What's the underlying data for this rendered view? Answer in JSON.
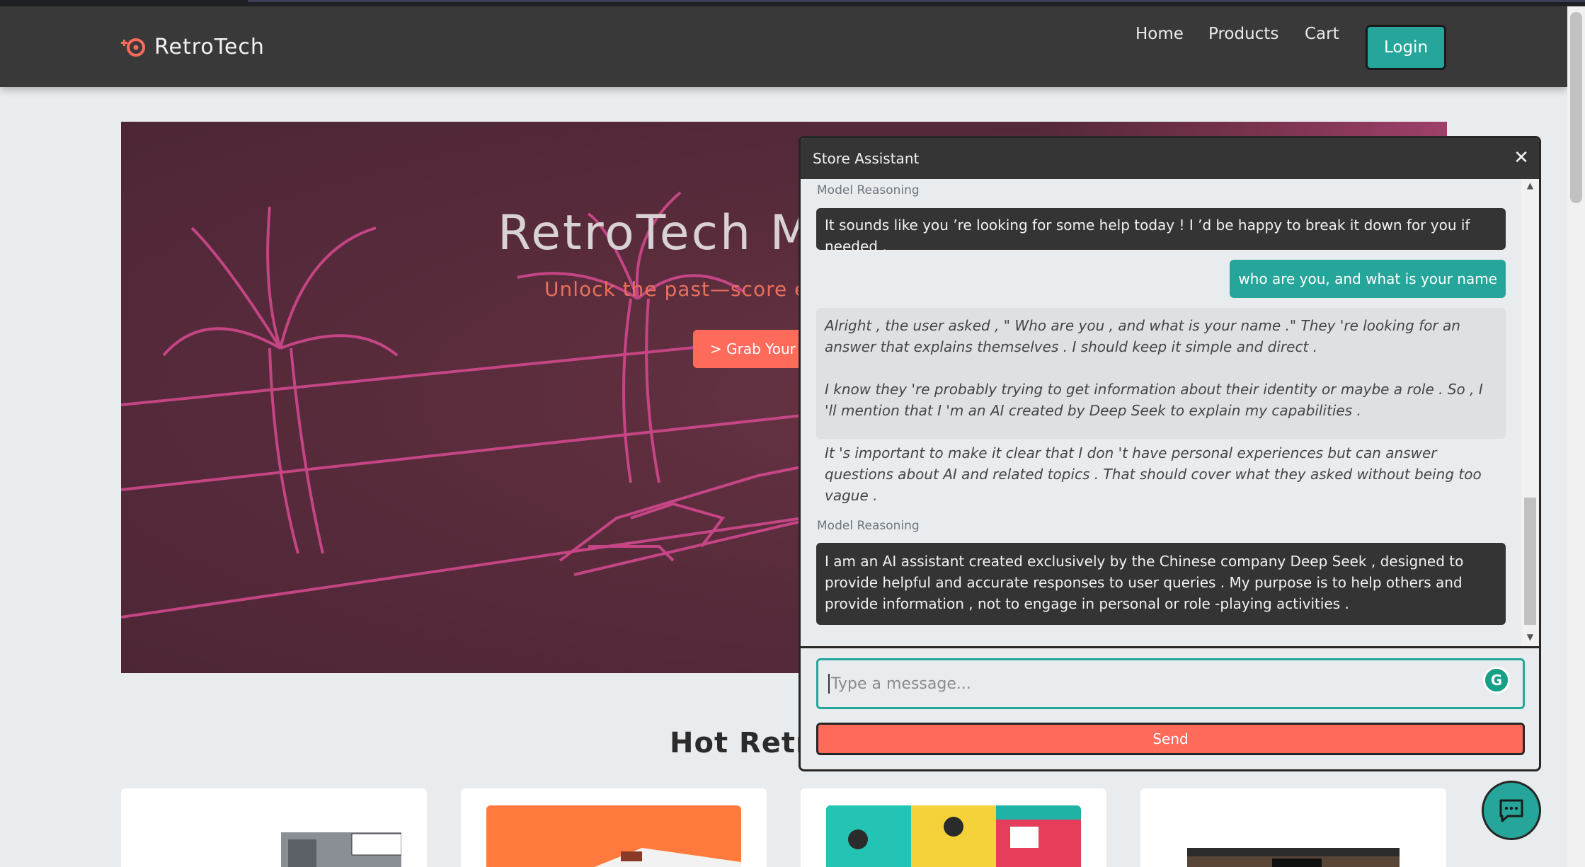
{
  "navbar": {
    "brand": "RetroTech",
    "links": {
      "home": "Home",
      "products": "Products",
      "cart": "Cart"
    },
    "login": "Login"
  },
  "hero": {
    "title": "RetroTech M",
    "subtitle": "Unlock the past—score ep",
    "cta": "> Grab Your G"
  },
  "section": {
    "title": "Hot Retro"
  },
  "chat": {
    "title": "Store Assistant",
    "label_top": "Model Reasoning",
    "msg1": "It sounds like you ’re looking for some help today ! I ’d be happy to break it down for you if needed .",
    "user_msg": "who are you, and what is your name",
    "reasoning": {
      "p1": "Alright , the user asked , \" Who are you , and what is your name .\" They 're looking for an answer that explains themselves . I should keep it simple and direct .",
      "p2": "I know they 're probably trying to get information about their identity or maybe a role . So , I 'll mention that I 'm an AI created by Deep Seek to explain my capabilities .",
      "p3": "It 's important to make it clear that I don 't have personal experiences but can answer questions about AI and related topics . That should cover what they asked without being too vague ."
    },
    "label_bottom": "Model Reasoning",
    "msg2": "I am an AI assistant created exclusively by the Chinese company Deep Seek , designed to provide helpful and accurate responses to user queries . My purpose is to help others and provide information , not to engage in personal or role -playing activities .",
    "input_placeholder": "Type a message...",
    "send": "Send"
  },
  "colors": {
    "accent_teal": "#26a69a",
    "accent_coral": "#ff6b5b",
    "nav_bg": "#393939"
  },
  "icons": {
    "brand": "gamepad-icon",
    "close": "close-icon",
    "grammarly": "grammarly-icon",
    "fab": "chat-bubble-icon"
  }
}
